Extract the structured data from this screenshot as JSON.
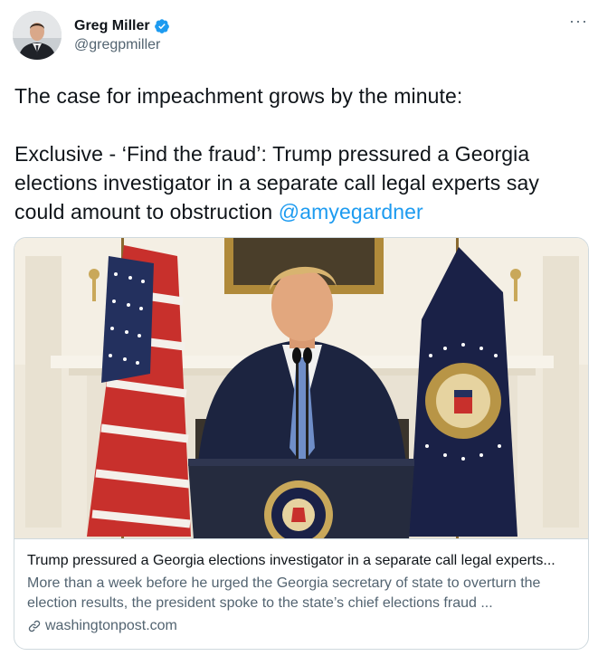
{
  "author": {
    "display_name": "Greg Miller",
    "handle": "@gregpmiller",
    "verified": true,
    "avatar_icon": "profile-photo"
  },
  "menu": {
    "more_label": "···"
  },
  "tweet": {
    "line1": "The case for impeachment grows by the minute:",
    "line2": "Exclusive - ‘Find the fraud’: Trump pressured a Georgia elections investigator in a separate call legal experts say could amount to obstruction ",
    "mention": "@amyegardner"
  },
  "link_card": {
    "title": "Trump pressured a Georgia elections investigator in a separate call legal experts...",
    "description": "More than a week before he urged the Georgia secretary of state to overturn the election results, the president spoke to the state’s chief elections fraud ...",
    "domain": "washingtonpost.com",
    "link_icon": "link-icon"
  },
  "colors": {
    "accent": "#1d9bf0",
    "text": "#0f1419",
    "secondary": "#536471",
    "border": "#cfd9de"
  }
}
